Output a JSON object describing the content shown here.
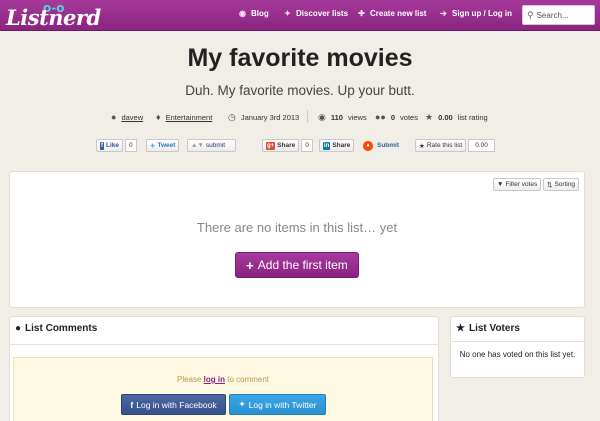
{
  "brand": {
    "logo_text": "Listnerd",
    "logo_glasses": "o-o"
  },
  "nav": {
    "items": [
      {
        "label": "Blog",
        "icon": "rss-icon"
      },
      {
        "label": "Discover lists",
        "icon": "compass-icon"
      },
      {
        "label": "Create new list",
        "icon": "plus-icon"
      },
      {
        "label": "Sign up / Log in",
        "icon": "login-icon"
      }
    ],
    "search_placeholder": "Search..."
  },
  "list": {
    "title": "My favorite movies",
    "subtitle": "Duh. My favorite movies. Up your butt.",
    "author": "davew",
    "category": "Entertainment",
    "date": "January 3rd 2013",
    "views_count": "110",
    "views_label": "views",
    "votes_count": "0",
    "votes_label": "votes",
    "rating_value": "0.00",
    "rating_label": "list rating"
  },
  "social": {
    "like_label": "Like",
    "like_count": "0",
    "tweet_label": "Tweet",
    "digg_label": "submit",
    "gplus_label": "Share",
    "gplus_count": "0",
    "linkedin_label": "Share",
    "reddit_label": "Submit",
    "rate_label": "Rate this list",
    "rate_value": "0.00"
  },
  "items_panel": {
    "filter_label": "Filter votes",
    "sorting_label": "Sorting",
    "empty_message": "There are no items in this list… yet",
    "add_button": "Add the first item"
  },
  "comments": {
    "heading": "List Comments",
    "prompt_before": "Please ",
    "prompt_link": "log in",
    "prompt_after": " to comment",
    "facebook_button": "Log in with Facebook",
    "twitter_button": "Log in with Twitter"
  },
  "voters": {
    "heading": "List Voters",
    "empty_message": "No one has voted on this list yet."
  },
  "colors": {
    "brand": "#8b2383",
    "facebook": "#3b5998",
    "twitter": "#2b8fcf"
  }
}
